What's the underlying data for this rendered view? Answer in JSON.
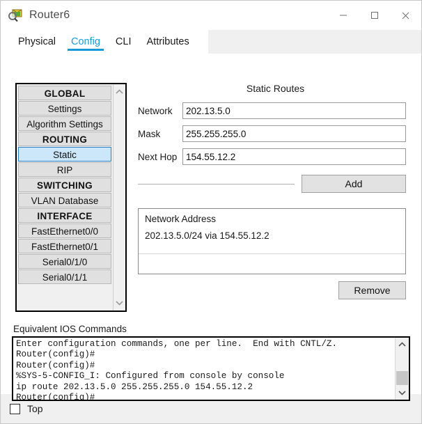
{
  "window": {
    "title": "Router6",
    "icon": "router-package-icon",
    "controls": {
      "minimize": "—",
      "maximize": "☐",
      "close": "✕"
    }
  },
  "tabs": [
    {
      "label": "Physical",
      "active": false
    },
    {
      "label": "Config",
      "active": true
    },
    {
      "label": "CLI",
      "active": false
    },
    {
      "label": "Attributes",
      "active": false
    }
  ],
  "sidebar": {
    "items": [
      {
        "label": "GLOBAL",
        "type": "header"
      },
      {
        "label": "Settings",
        "type": "item"
      },
      {
        "label": "Algorithm Settings",
        "type": "item"
      },
      {
        "label": "ROUTING",
        "type": "header"
      },
      {
        "label": "Static",
        "type": "item",
        "selected": true
      },
      {
        "label": "RIP",
        "type": "item"
      },
      {
        "label": "SWITCHING",
        "type": "header"
      },
      {
        "label": "VLAN Database",
        "type": "item"
      },
      {
        "label": "INTERFACE",
        "type": "header"
      },
      {
        "label": "FastEthernet0/0",
        "type": "item"
      },
      {
        "label": "FastEthernet0/1",
        "type": "item"
      },
      {
        "label": "Serial0/1/0",
        "type": "item"
      },
      {
        "label": "Serial0/1/1",
        "type": "item"
      }
    ],
    "scroll_up": "▲",
    "scroll_down": "▼"
  },
  "static_routes": {
    "title": "Static Routes",
    "fields": [
      {
        "label": "Network",
        "value": "202.13.5.0",
        "placeholder": ""
      },
      {
        "label": "Mask",
        "value": "255.255.255.0",
        "placeholder": ""
      },
      {
        "label": "Next Hop",
        "value": "154.55.12.2",
        "placeholder": ""
      }
    ],
    "add_label": "Add",
    "remove_label": "Remove",
    "list_header": "Network Address",
    "list_entries": [
      "202.13.5.0/24 via 154.55.12.2"
    ]
  },
  "console": {
    "label": "Equivalent IOS Commands",
    "lines": [
      "Enter configuration commands, one per line.  End with CNTL/Z.",
      "Router(config)#",
      "Router(config)#",
      "%SYS-5-CONFIG_I: Configured from console by console",
      "ip route 202.13.5.0 255.255.255.0 154.55.12.2",
      "Router(config)#"
    ],
    "scroll_up": "▲",
    "scroll_down": "▼"
  },
  "footer": {
    "top_label": "Top",
    "top_checked": false
  },
  "colors": {
    "accent": "#1b9ad7",
    "selection": "#cce6fa",
    "selection_border": "#2a7fc9",
    "panel": "#f0f0f0"
  }
}
